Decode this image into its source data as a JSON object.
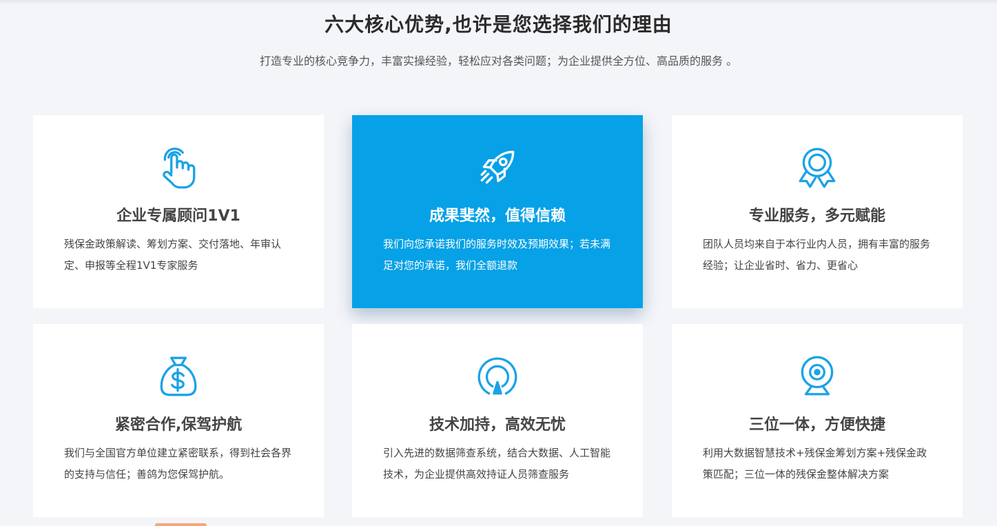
{
  "section": {
    "title": "六大核心优势,也许是您选择我们的理由",
    "subtitle": "打造专业的核心竞争力，丰富实操经验，轻松应对各类问题；为企业提供全方位、高品质的服务 。"
  },
  "colors": {
    "accent": "#06a1e6",
    "background": "#f4f5f9",
    "card": "#ffffff",
    "text": "#444444"
  },
  "cards": [
    {
      "icon": "pointing-hand-icon",
      "title": "企业专属顾问1V1",
      "desc": "残保金政策解读、筹划方案、交付落地、年审认定、申报等全程1V1专家服务"
    },
    {
      "icon": "rocket-icon",
      "title": "成果斐然，值得信赖",
      "desc": "我们向您承诺我们的服务时效及预期效果；若未满足对您的承诺，我们全额退款"
    },
    {
      "icon": "award-badge-icon",
      "title": "专业服务，多元赋能",
      "desc": "团队人员均来自于本行业内人员，拥有丰富的服务经验；让企业省时、省力、更省心"
    },
    {
      "icon": "money-bag-icon",
      "title": "紧密合作,保驾护航",
      "desc": "我们与全国官方单位建立紧密联系，得到社会各界的支持与信任；善鸽为您保驾护航。"
    },
    {
      "icon": "signal-target-icon",
      "title": "技术加持，高效无忧",
      "desc": "引入先进的数据筛查系统，结合大数据、人工智能技术，为企业提供高效持证人员筛查服务"
    },
    {
      "icon": "webcam-icon",
      "title": "三位一体，方便快捷",
      "desc": "利用大数据智慧技术+残保金筹划方案+残保金政策匹配；三位一体的残保金整体解决方案"
    }
  ]
}
